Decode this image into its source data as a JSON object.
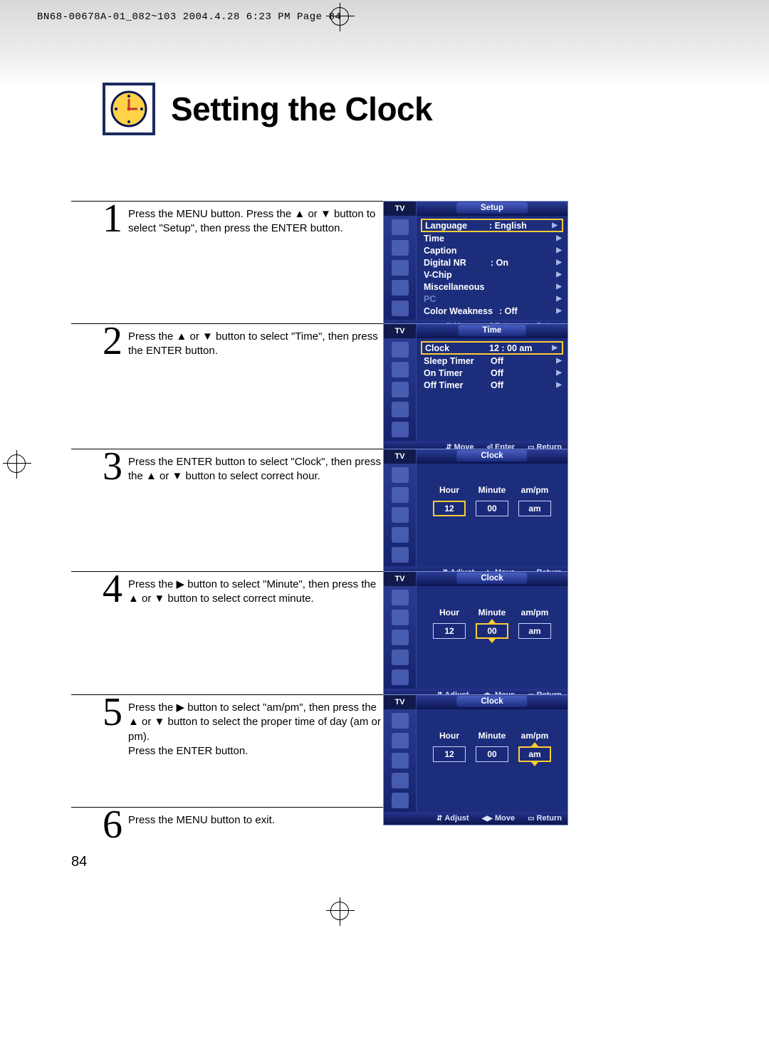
{
  "print_info": "BN68-00678A-01_082~103  2004.4.28  6:23 PM  Page 84",
  "page_title": "Setting the Clock",
  "page_number": "84",
  "steps": {
    "s1": {
      "num": "1",
      "text": "Press the MENU button. Press the ▲ or ▼ button to select \"Setup\", then press the ENTER button."
    },
    "s2": {
      "num": "2",
      "text": "Press the ▲ or ▼ button to select \"Time\", then press the ENTER button."
    },
    "s3": {
      "num": "3",
      "text": "Press the ENTER button to select \"Clock\", then press the ▲ or ▼ button to select correct hour."
    },
    "s4": {
      "num": "4",
      "text": "Press the ▶ button to select \"Minute\", then press the ▲ or ▼ button to select correct minute."
    },
    "s5": {
      "num": "5",
      "text": "Press the ▶ button to select \"am/pm\", then press the ▲ or ▼ button to select the proper time of day (am or pm).\nPress the ENTER button."
    },
    "s6": {
      "num": "6",
      "text": "Press the MENU button to exit."
    }
  },
  "osd": {
    "tv_label": "TV",
    "footer": {
      "move": "Move",
      "enter": "Enter",
      "return": "Return",
      "adjust": "Adjust"
    },
    "setup": {
      "title": "Setup",
      "items": {
        "language": {
          "label": "Language",
          "value": ": English"
        },
        "time": {
          "label": "Time",
          "value": ""
        },
        "caption": {
          "label": "Caption",
          "value": ""
        },
        "digital_nr": {
          "label": "Digital NR",
          "value": ": On"
        },
        "vchip": {
          "label": "V-Chip",
          "value": ""
        },
        "misc": {
          "label": "Miscellaneous",
          "value": ""
        },
        "pc": {
          "label": "PC",
          "value": ""
        },
        "color_weakness": {
          "label": "Color Weakness",
          "value": ": Off"
        }
      }
    },
    "time": {
      "title": "Time",
      "items": {
        "clock": {
          "label": "Clock",
          "value": "12 : 00 am"
        },
        "sleep_timer": {
          "label": "Sleep Timer",
          "value": "Off"
        },
        "on_timer": {
          "label": "On Timer",
          "value": "Off"
        },
        "off_timer": {
          "label": "Off Timer",
          "value": "Off"
        }
      }
    },
    "clock": {
      "title": "Clock",
      "labels": {
        "hour": "Hour",
        "minute": "Minute",
        "ampm": "am/pm"
      },
      "p3": {
        "hour": "12",
        "minute": "00",
        "ampm": "am"
      },
      "p4": {
        "hour": "12",
        "minute": "00",
        "ampm": "am"
      },
      "p5": {
        "hour": "12",
        "minute": "00",
        "ampm": "am"
      }
    }
  }
}
